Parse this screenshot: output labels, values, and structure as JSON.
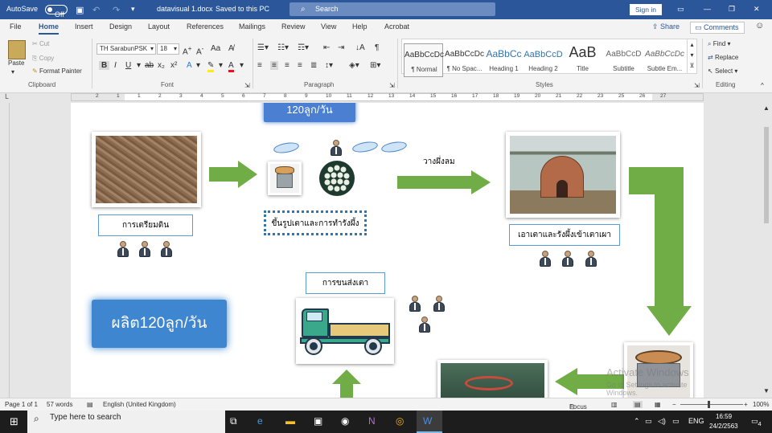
{
  "titlebar": {
    "autosave_label": "AutoSave",
    "autosave_state": "Off",
    "doc_title": "datavisual 1.docx",
    "save_status": "Saved to this PC",
    "search_placeholder": "Search",
    "signin_label": "Sign in"
  },
  "menu_tabs": [
    "File",
    "Home",
    "Insert",
    "Design",
    "Layout",
    "References",
    "Mailings",
    "Review",
    "View",
    "Help",
    "Acrobat"
  ],
  "share_label": "Share",
  "comments_label": "Comments",
  "clipboard": {
    "paste": "Paste",
    "cut": "Cut",
    "copy": "Copy",
    "format_painter": "Format Painter",
    "group": "Clipboard"
  },
  "font": {
    "name": "TH SarabunPSK",
    "size": "18",
    "group": "Font"
  },
  "paragraph_group": "Paragraph",
  "styles": {
    "items": [
      {
        "preview": "AaBbCcDc",
        "name": "¶ Normal"
      },
      {
        "preview": "AaBbCcDc",
        "name": "¶ No Spac..."
      },
      {
        "preview": "AaBbCc",
        "name": "Heading 1"
      },
      {
        "preview": "AaBbCcD",
        "name": "Heading 2"
      },
      {
        "preview": "AaB",
        "name": "Title"
      },
      {
        "preview": "AaBbCcD",
        "name": "Subtitle"
      },
      {
        "preview": "AaBbCcDc",
        "name": "Subtle Em..."
      }
    ],
    "group": "Styles"
  },
  "editing": {
    "find": "Find",
    "replace": "Replace",
    "select": "Select",
    "group": "Editing"
  },
  "ruler_numbers": [
    "2",
    "1",
    "1",
    "2",
    "3",
    "4",
    "5",
    "6",
    "7",
    "8",
    "9",
    "10",
    "11",
    "12",
    "13",
    "14",
    "15",
    "16",
    "17",
    "18",
    "19",
    "20",
    "21",
    "22",
    "23",
    "25",
    "26",
    "27"
  ],
  "diagram": {
    "top_box": "120ลูก/วัน",
    "step1_label": "การเตรียมดิน",
    "step2_label": "ขึ้นรูปเตาและการทำรังผึ้ง",
    "air_dry_label": "วางผึ่งลม",
    "step3_label": "เอาเตาและรังผึ้งเข้าเตาเผา",
    "transport_label": "การขนส่งเตา",
    "production_label": "ผลิต120ลูก/วัน"
  },
  "watermark": {
    "line1": "Activate Windows",
    "line2": "Go to Settings to activate Windows."
  },
  "statusbar": {
    "page": "Page 1 of 1",
    "words": "57 words",
    "language": "English (United Kingdom)",
    "focus": "Focus",
    "zoom": "100%"
  },
  "taskbar": {
    "search_placeholder": "Type here to search",
    "lang": "ENG",
    "time": "16:59",
    "date": "24/2/2563",
    "notifications": "4"
  }
}
